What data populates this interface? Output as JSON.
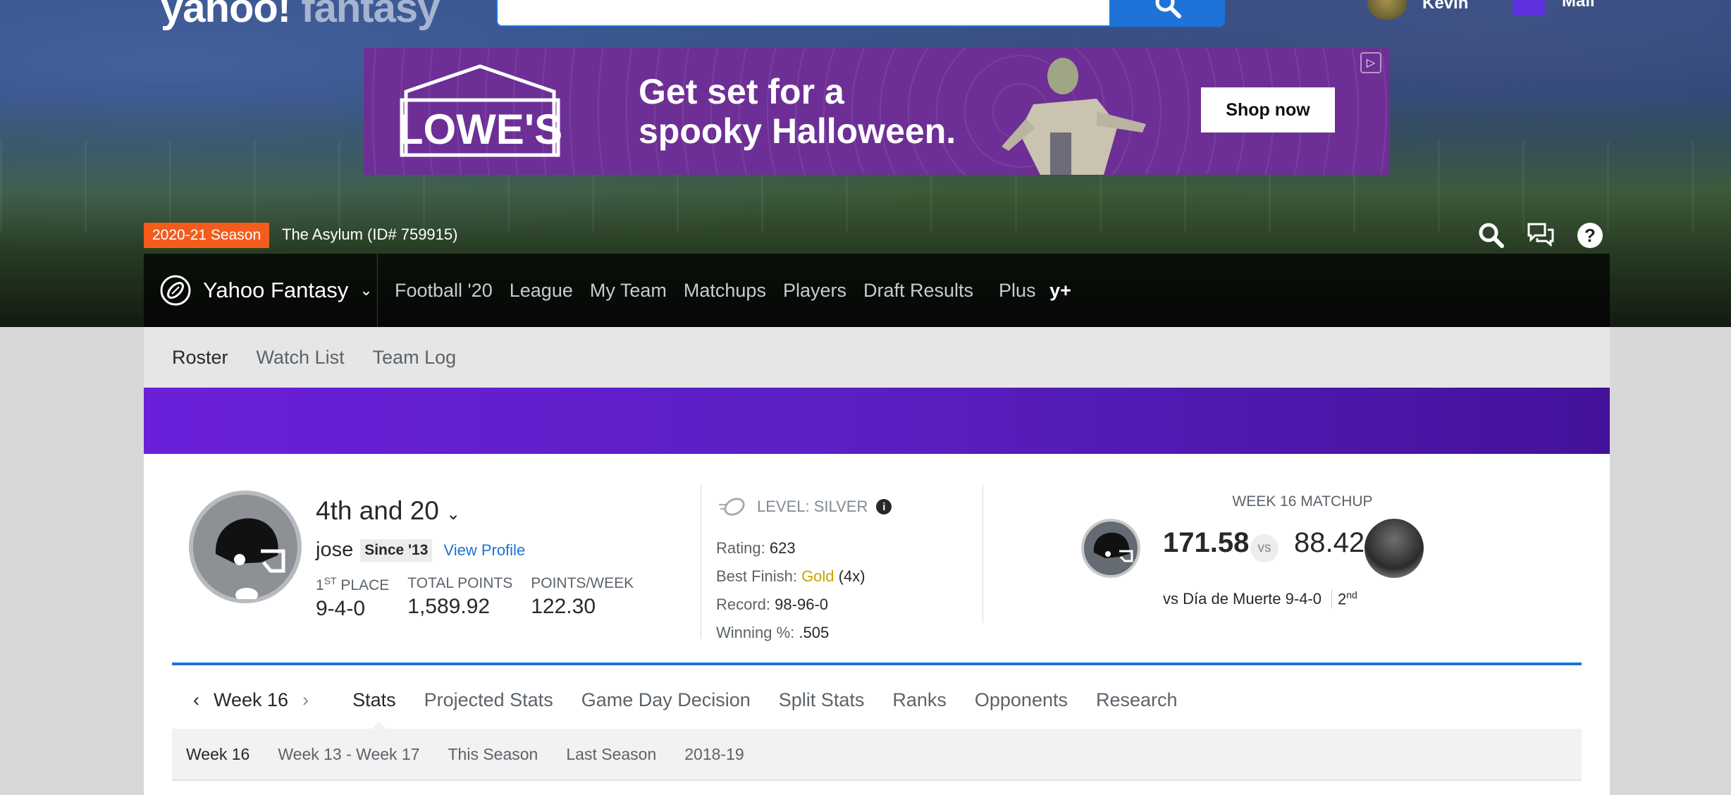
{
  "header": {
    "logo_main": "yahoo!",
    "logo_sub": "fantasy",
    "user_name": "Kevin",
    "mail_label": "Mail"
  },
  "ad": {
    "brand": "LOWE'S",
    "line1": "Get set for a",
    "line2": "spooky Halloween.",
    "cta": "Shop now"
  },
  "season": {
    "badge": "2020-21 Season",
    "league": "The Asylum (ID# 759915)"
  },
  "nav": {
    "brand": "Yahoo Fantasy",
    "links": [
      "Football '20",
      "League",
      "My Team",
      "Matchups",
      "Players",
      "Draft Results",
      "Plus"
    ],
    "plus_mark": "y+"
  },
  "subnav": [
    "Roster",
    "Watch List",
    "Team Log"
  ],
  "team": {
    "name": "4th and 20",
    "owner": "jose",
    "since": "Since '13",
    "view_profile": "View Profile",
    "place_label_num": "1",
    "place_label_sup": "ST",
    "place_label": " PLACE",
    "record": "9-4-0",
    "total_points_label": "TOTAL POINTS",
    "total_points": "1,589.92",
    "ppw_label": "POINTS/WEEK",
    "ppw": "122.30"
  },
  "level": {
    "label": "LEVEL: SILVER",
    "rating_label": "Rating:",
    "rating": "623",
    "best_label": "Best Finish:",
    "best_value": "Gold",
    "best_count": "(4x)",
    "record_label": "Record:",
    "record": "98-96-0",
    "win_label": "Winning %:",
    "win": ".505"
  },
  "matchup": {
    "title": "WEEK 16 MATCHUP",
    "my_score": "171.58",
    "vs": "vs",
    "opp_score": "88.42",
    "opp_text": "vs Día de Muerte 9-4-0",
    "opp_rank": "2",
    "opp_rank_sup": "nd"
  },
  "tabs": {
    "week": "Week 16",
    "items": [
      "Stats",
      "Projected Stats",
      "Game Day Decision",
      "Split Stats",
      "Ranks",
      "Opponents",
      "Research"
    ]
  },
  "subtabs": [
    "Week 16",
    "Week 13 - Week 17",
    "This Season",
    "Last Season",
    "2018-19"
  ],
  "colors": {
    "accent": "#1d73d8",
    "season_badge": "#f55c1b",
    "banner": "#5a1fc2",
    "gold": "#c7a400"
  }
}
